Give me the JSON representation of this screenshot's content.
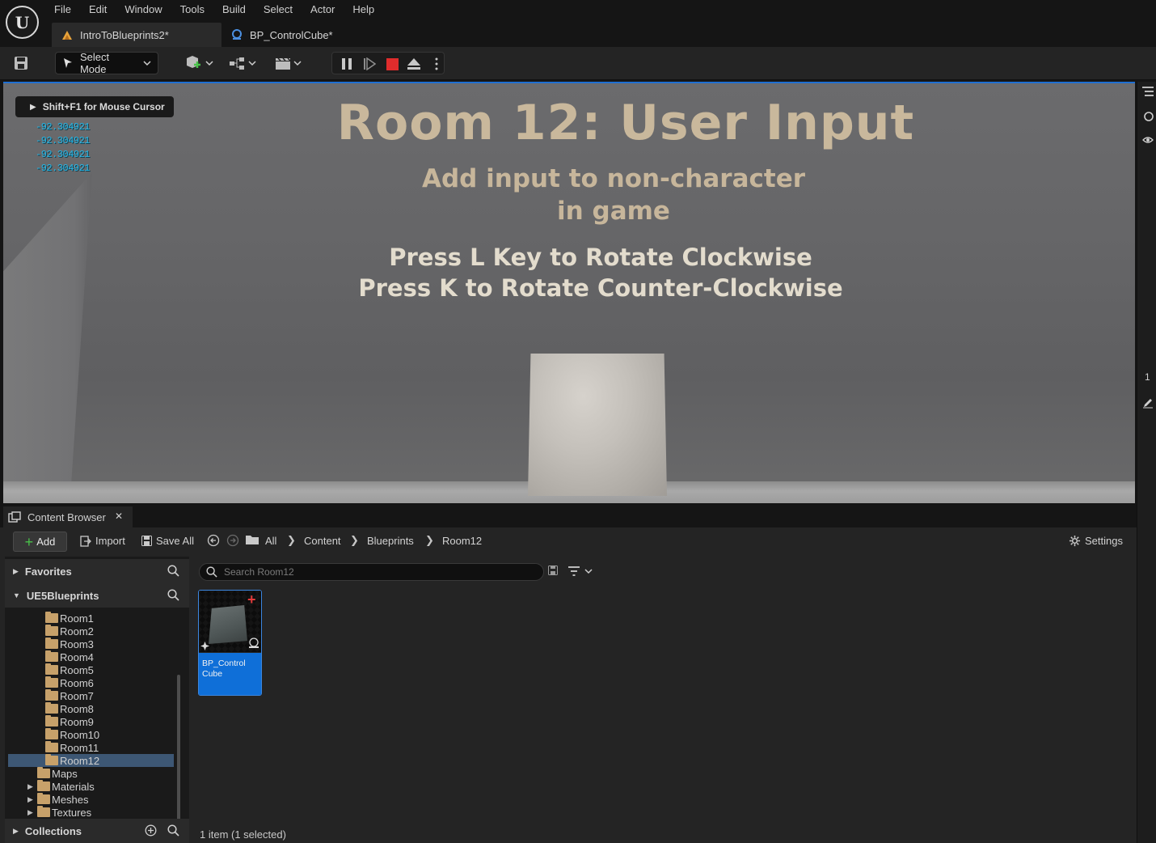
{
  "app": {
    "menu": [
      "File",
      "Edit",
      "Window",
      "Tools",
      "Build",
      "Select",
      "Actor",
      "Help"
    ],
    "tabs": [
      {
        "label": "IntroToBlueprints2*",
        "icon": "level-icon"
      },
      {
        "label": "BP_ControlCube*",
        "icon": "blueprint-icon"
      }
    ]
  },
  "toolbar": {
    "select_mode_label": "Select Mode"
  },
  "viewport": {
    "title": "Room 12: User Input",
    "subtitle_line1": "Add input to non-character",
    "subtitle_line2": "in game",
    "instruction_line1": "Press L Key to Rotate Clockwise",
    "instruction_line2": "Press K to Rotate Counter-Clockwise",
    "mouse_hint": "Shift+F1 for Mouse Cursor",
    "debug_values": [
      "-92.304921",
      "-92.304921",
      "-92.304921",
      "-92.304921"
    ]
  },
  "content_browser": {
    "tab_label": "Content Browser",
    "add_label": "Add",
    "import_label": "Import",
    "save_all_label": "Save All",
    "breadcrumb": [
      "All",
      "Content",
      "Blueprints",
      "Room12"
    ],
    "settings_label": "Settings",
    "favorites_label": "Favorites",
    "project_label": "UE5Blueprints",
    "collections_label": "Collections",
    "folders": [
      "Room1",
      "Room2",
      "Room3",
      "Room4",
      "Room5",
      "Room6",
      "Room7",
      "Room8",
      "Room9",
      "Room10",
      "Room11",
      "Room12"
    ],
    "selected_folder": "Room12",
    "other_folders": [
      "Maps",
      "Materials",
      "Meshes",
      "Textures"
    ],
    "search_placeholder": "Search Room12",
    "asset_name": "BP_Control Cube",
    "status": "1 item (1 selected)"
  },
  "colors": {
    "accent": "#0f6fd8",
    "selection": "#3d5774",
    "folder": "#c7a16a",
    "debug_text": "#25b6e6",
    "stop": "#e02c2c"
  }
}
